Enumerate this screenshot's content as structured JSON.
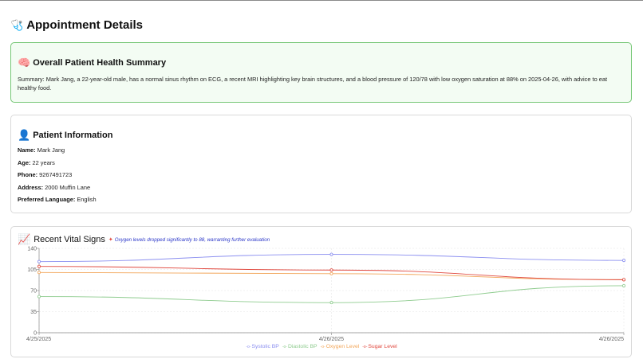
{
  "page": {
    "title": "Appointment Details",
    "title_icon": "stethoscope-icon"
  },
  "summary": {
    "title": "Overall Patient Health Summary",
    "icon": "brain-icon",
    "text": "Summary: Mark Jang, a 22-year-old male, has a normal sinus rhythm on ECG, a recent MRI highlighting key brain structures, and a blood pressure of 120/78 with low oxygen saturation at 88% on 2025-04-26, with advice to eat healthy food."
  },
  "patient": {
    "title": "Patient Information",
    "icon": "person-icon",
    "fields": [
      {
        "label": "Name:",
        "value": "Mark Jang"
      },
      {
        "label": "Age:",
        "value": "22 years"
      },
      {
        "label": "Phone:",
        "value": "9267491723"
      },
      {
        "label": "Address:",
        "value": "2000 Muffin Lane"
      },
      {
        "label": "Preferred Language:",
        "value": "English"
      }
    ]
  },
  "vitals": {
    "title": "Recent Vital Signs",
    "icon": "chart-increasing-icon",
    "alert_icon": "sparkle-icon",
    "alert": "Oxygen levels dropped significantly to 88, warranting further evaluation"
  },
  "colors": {
    "systolic": "#8b8ff0",
    "diastolic": "#8fcc8f",
    "oxygen": "#f2a65a",
    "sugar": "#e0483e",
    "summary_border": "#76c776",
    "summary_bg": "#f3fcf3"
  },
  "chart_data": {
    "type": "line",
    "categories": [
      "4/25/2025",
      "4/26/2025",
      "4/26/2025"
    ],
    "ylim": [
      0,
      140
    ],
    "yticks": [
      "0",
      "35",
      "70",
      "105",
      "140"
    ],
    "grid": true,
    "legend": "bottom",
    "series": [
      {
        "name": "Systolic BP",
        "values": [
          118,
          130,
          120
        ]
      },
      {
        "name": "Diastolic BP",
        "values": [
          60,
          50,
          78
        ]
      },
      {
        "name": "Oxygen Level",
        "values": [
          100,
          98,
          88
        ]
      },
      {
        "name": "Sugar Level",
        "values": [
          110,
          104,
          88
        ]
      }
    ]
  }
}
